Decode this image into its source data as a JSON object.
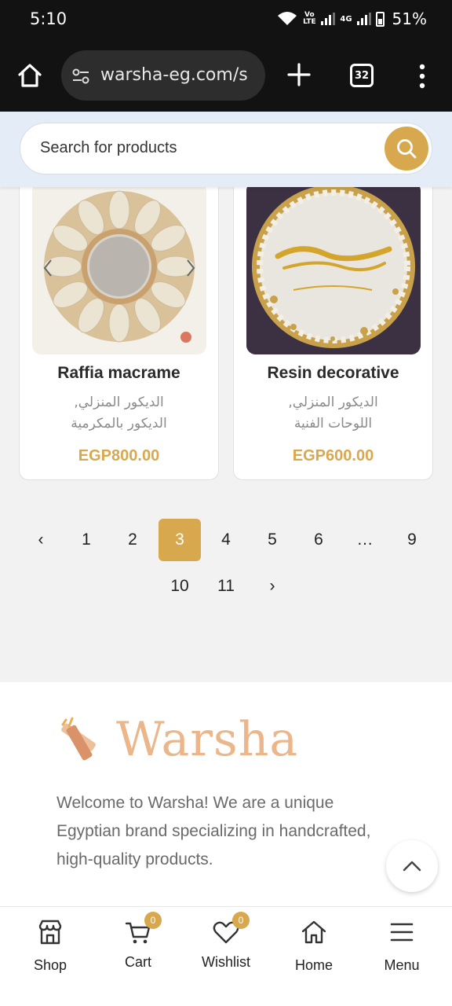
{
  "status_bar": {
    "time": "5:10",
    "volte_label": "Vo LTE",
    "network_label": "4G",
    "battery": "51%"
  },
  "browser": {
    "url": "warsha-eg.com/s",
    "tab_count": "32"
  },
  "search": {
    "placeholder": "Search for products"
  },
  "products": [
    {
      "name": "Raffia macrame",
      "categories_line1": "الديكور المنزلي,",
      "categories_line2": "الديكور بالمكرمية",
      "price": "EGP800.00"
    },
    {
      "name": "Resin decorative",
      "categories_line1": "الديكور المنزلي,",
      "categories_line2": "اللوحات الفنية",
      "price": "EGP600.00"
    }
  ],
  "pagination": {
    "prev": "‹",
    "next": "›",
    "pages": [
      "1",
      "2",
      "3",
      "4",
      "5",
      "6",
      "…",
      "9",
      "10",
      "11"
    ],
    "current": "3"
  },
  "footer": {
    "logo_text": "Warsha",
    "welcome": "Welcome to Warsha! We are a unique Egyptian brand specializing in handcrafted, high-quality products."
  },
  "bottom_nav": {
    "shop": "Shop",
    "cart": "Cart",
    "cart_count": "0",
    "wishlist": "Wishlist",
    "wishlist_count": "0",
    "home": "Home",
    "menu": "Menu"
  },
  "colors": {
    "accent": "#d8a84f",
    "header_bg": "#e4ecf8",
    "logo": "#ebb68a"
  }
}
